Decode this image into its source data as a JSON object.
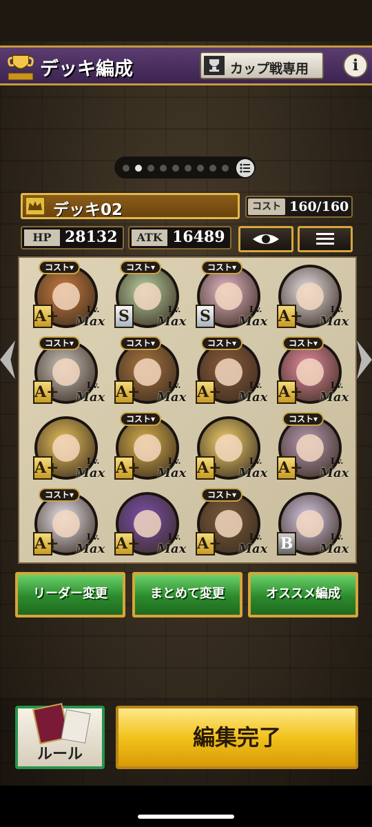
{
  "header": {
    "title": "デッキ編成",
    "cup_label": "カップ戦専用",
    "info_label": "i"
  },
  "pager": {
    "page_count": 9,
    "active_index": 1
  },
  "deck": {
    "name": "デッキ02",
    "cost_label": "コスト",
    "cost_value": "160/160",
    "hp_label": "HP",
    "hp_value": "28132",
    "atk_label": "ATK",
    "atk_value": "16489"
  },
  "cards": [
    {
      "cost_tag": "コスト▾",
      "rank": "A+",
      "lv": "Lv.",
      "max": "Max",
      "tone": "#c97b3d"
    },
    {
      "cost_tag": "コスト▾",
      "rank": "S",
      "lv": "Lv.",
      "max": "Max",
      "tone": "#b7d1a1"
    },
    {
      "cost_tag": "コスト▾",
      "rank": "S",
      "lv": "Lv.",
      "max": "Max",
      "tone": "#e6b8c9"
    },
    {
      "cost_tag": "",
      "rank": "A+",
      "lv": "Lv.",
      "max": "Max",
      "tone": "#e8e2e6"
    },
    {
      "cost_tag": "コスト▾",
      "rank": "A+",
      "lv": "Lv.",
      "max": "Max",
      "tone": "#c9c2bb"
    },
    {
      "cost_tag": "コスト▾",
      "rank": "A+",
      "lv": "Lv.",
      "max": "Max",
      "tone": "#a9743e"
    },
    {
      "cost_tag": "コスト▾",
      "rank": "A+",
      "lv": "Lv.",
      "max": "Max",
      "tone": "#8a5a3a"
    },
    {
      "cost_tag": "コスト▾",
      "rank": "A+",
      "lv": "Lv.",
      "max": "Max",
      "tone": "#e58aa0"
    },
    {
      "cost_tag": "",
      "rank": "A+",
      "lv": "Lv.",
      "max": "Max",
      "tone": "#e9c15a"
    },
    {
      "cost_tag": "コスト▾",
      "rank": "A+",
      "lv": "Lv.",
      "max": "Max",
      "tone": "#d9b04a"
    },
    {
      "cost_tag": "",
      "rank": "A+",
      "lv": "Lv.",
      "max": "Max",
      "tone": "#f0d06a"
    },
    {
      "cost_tag": "コスト▾",
      "rank": "A+",
      "lv": "Lv.",
      "max": "Max",
      "tone": "#b79ab5"
    },
    {
      "cost_tag": "コスト▾",
      "rank": "A+",
      "lv": "Lv.",
      "max": "Max",
      "tone": "#e9e4ee"
    },
    {
      "cost_tag": "",
      "rank": "A+",
      "lv": "Lv.",
      "max": "Max",
      "tone": "#7a4fb0"
    },
    {
      "cost_tag": "コスト▾",
      "rank": "A+",
      "lv": "Lv.",
      "max": "Max",
      "tone": "#7a5a3a"
    },
    {
      "cost_tag": "",
      "rank": "B",
      "lv": "Lv.",
      "max": "Max",
      "tone": "#d7c8e6"
    }
  ],
  "buttons": {
    "leader_change": "リーダー変更",
    "bulk_change": "まとめて変更",
    "recommended": "オススメ編成",
    "rule": "ルール",
    "done": "編集完了"
  }
}
